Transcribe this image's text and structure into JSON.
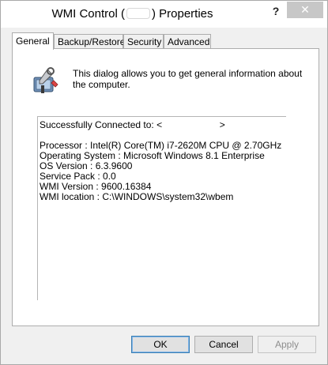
{
  "window": {
    "title_prefix": "WMI Control (",
    "title_suffix": ") Properties",
    "help_label": "?",
    "close_label": "✕"
  },
  "tabs": [
    {
      "label": "General",
      "active": true
    },
    {
      "label": "Backup/Restore",
      "active": false
    },
    {
      "label": "Security",
      "active": false
    },
    {
      "label": "Advanced",
      "active": false
    }
  ],
  "general": {
    "intro": "This dialog allows you to get general information about the computer.",
    "connected_prefix": "Successfully Connected to:",
    "connected_target_open": "<",
    "connected_target_close": ">",
    "details": [
      "Processor :  Intel(R) Core(TM) i7-2620M CPU @ 2.70GHz",
      "Operating System :  Microsoft Windows 8.1 Enterprise",
      "OS Version :  6.3.9600",
      "Service Pack :  0.0",
      "WMI Version :  9600.16384",
      "WMI location :  C:\\WINDOWS\\system32\\wbem"
    ]
  },
  "buttons": {
    "ok": "OK",
    "cancel": "Cancel",
    "apply": "Apply"
  },
  "icons": {
    "intro": "wmi-tools-icon",
    "help": "help-icon",
    "close": "close-icon"
  }
}
